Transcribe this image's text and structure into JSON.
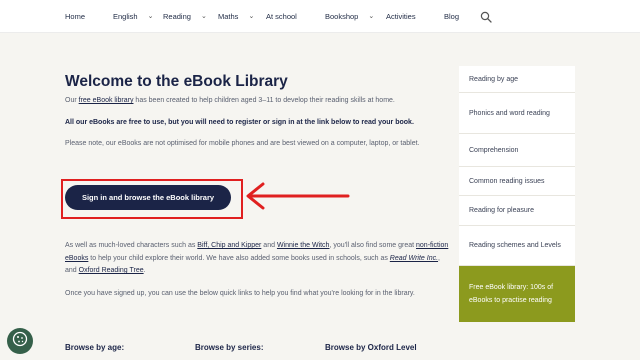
{
  "nav": {
    "items": [
      {
        "label": "Home",
        "dropdown": false
      },
      {
        "label": "English",
        "dropdown": true
      },
      {
        "label": "Reading",
        "dropdown": true
      },
      {
        "label": "Maths",
        "dropdown": true
      },
      {
        "label": "At school",
        "dropdown": false
      },
      {
        "label": "Bookshop",
        "dropdown": true
      },
      {
        "label": "Activities",
        "dropdown": false
      },
      {
        "label": "Blog",
        "dropdown": false
      }
    ],
    "chevron": "⌄",
    "search_icon": "search-icon"
  },
  "main": {
    "title": "Welcome to the eBook Library",
    "intro": {
      "pre": "Our ",
      "link": "free eBook library",
      "post": " has been created to help children aged 3–11 to develop their reading skills at home."
    },
    "notice_bold": "All our eBooks are free to use, but you will need to register or sign in at the link below to read your book.",
    "note": "Please note, our eBooks are not optimised for mobile phones and are best viewed on a computer, laptop, or tablet.",
    "cta_label": "Sign in and browse the eBook library",
    "characters": {
      "t1": "As well as much-loved characters such as ",
      "link1": "Biff, Chip and Kipper",
      "t2": " and ",
      "link2": "Winnie the Witch",
      "t3": ", you'll also find some great ",
      "link3": "non-fiction eBooks",
      "t4": " to help your child explore their world. We have also added some books used in schools, such as ",
      "link4": "Read Write Inc.",
      "t5": ", and ",
      "link5": "Oxford Reading Tree",
      "t6": "."
    },
    "quicklinks": "Once you have signed up, you can use the below quick links to help you find what you're looking for in the library.",
    "browse": [
      "Browse by age:",
      "Browse by series:",
      "Browse by Oxford Level"
    ]
  },
  "sidebar": {
    "items": [
      {
        "label": "Reading by age"
      },
      {
        "label": "Phonics and word reading"
      },
      {
        "label": "Comprehension"
      },
      {
        "label": "Common reading issues"
      },
      {
        "label": "Reading for pleasure"
      },
      {
        "label": "Reading schemes and Levels"
      },
      {
        "label": "Free eBook library: 100s of eBooks to practise reading"
      }
    ],
    "active_index": 6
  },
  "colors": {
    "navy": "#1b2447",
    "accent_green": "#8c9a1e",
    "highlight_red": "#e02020",
    "cookie_green": "#35604a",
    "page_bg": "#f6f5f1"
  },
  "cookie": {
    "icon": "cookie-icon"
  }
}
